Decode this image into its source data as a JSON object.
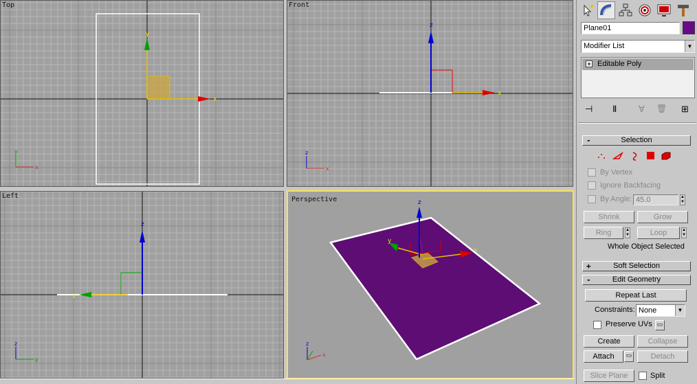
{
  "viewports": {
    "top": {
      "label": "Top",
      "axis_x": "x",
      "axis_y": "y"
    },
    "front": {
      "label": "Front",
      "axis_x": "x",
      "axis_z": "z"
    },
    "left": {
      "label": "Left",
      "axis_y": "y",
      "axis_z": "z"
    },
    "perspective": {
      "label": "Perspective",
      "axis_x": "x",
      "axis_y": "y",
      "axis_z": "z"
    }
  },
  "command_panel": {
    "tabs": [
      "create-tab",
      "modify-tab",
      "hierarchy-tab",
      "motion-tab",
      "display-tab",
      "utilities-tab"
    ],
    "object_name": "Plane01",
    "object_color": "#6a0a8a",
    "modifier_list": "Modifier List",
    "stack_item": "Editable Poly",
    "selection": {
      "header": "Selection",
      "by_vertex": "By Vertex",
      "ignore_backfacing": "Ignore Backfacing",
      "by_angle": "By Angle:",
      "angle_value": "45.0",
      "shrink": "Shrink",
      "grow": "Grow",
      "ring": "Ring",
      "loop": "Loop",
      "status": "Whole Object Selected"
    },
    "soft_selection": {
      "header": "Soft Selection"
    },
    "edit_geometry": {
      "header": "Edit Geometry",
      "repeat_last": "Repeat Last",
      "constraints_label": "Constraints:",
      "constraints_value": "None",
      "preserve_uvs": "Preserve UVs",
      "create": "Create",
      "collapse": "Collapse",
      "attach": "Attach",
      "detach": "Detach",
      "slice_plane": "Slice Plane",
      "split": "Split"
    }
  },
  "colors": {
    "viewport_bg": "#a0a0a0",
    "active_border": "#ffe14a",
    "plane": "#5e0d74",
    "axis_x": "#e00000",
    "axis_y": "#00a000",
    "axis_z": "#0000d0"
  }
}
